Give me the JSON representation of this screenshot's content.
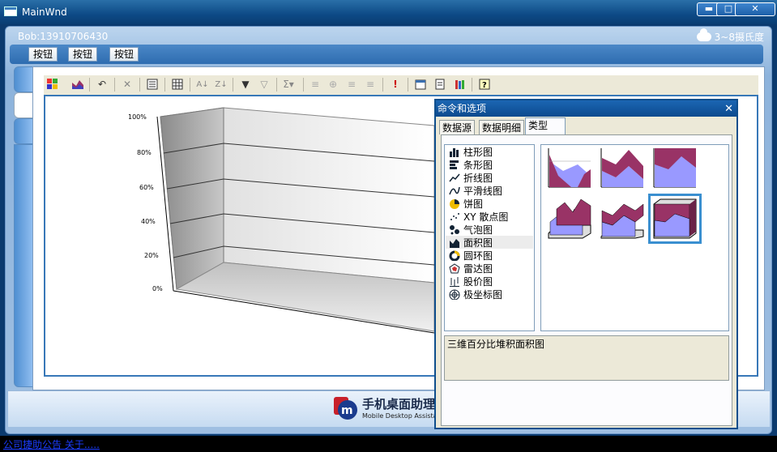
{
  "window": {
    "title": "MainWnd",
    "min": "▬",
    "max": "□",
    "close": "✕"
  },
  "header": {
    "user": "Bob:13910706430",
    "weather": "3~8摄氏度"
  },
  "topbar": {
    "buttons": [
      "按钮",
      "按钮",
      "按钮"
    ]
  },
  "chart": {
    "y_ticks": [
      "100%",
      "80%",
      "60%",
      "40%",
      "20%",
      "0%"
    ]
  },
  "dialog": {
    "title": "命令和选项",
    "close": "✕",
    "tabs": [
      "数据源",
      "数据明细",
      "类型"
    ],
    "active_tab": "类型",
    "chart_types": [
      "柱形图",
      "条形图",
      "折线图",
      "平滑线图",
      "饼图",
      "XY 散点图",
      "气泡图",
      "面积图",
      "圆环图",
      "雷达图",
      "股价图",
      "极坐标图"
    ],
    "selected_type": "面积图",
    "description": "三维百分比堆积面积图"
  },
  "footer": {
    "logo_cn": "手机桌面助理",
    "logo_en": "Mobile Desktop Assista",
    "status_link": "公司捷助公告 关于....."
  },
  "colors": {
    "area_dark": "#993366",
    "area_light": "#9999ff",
    "title_blue": "#0c4a8e"
  }
}
